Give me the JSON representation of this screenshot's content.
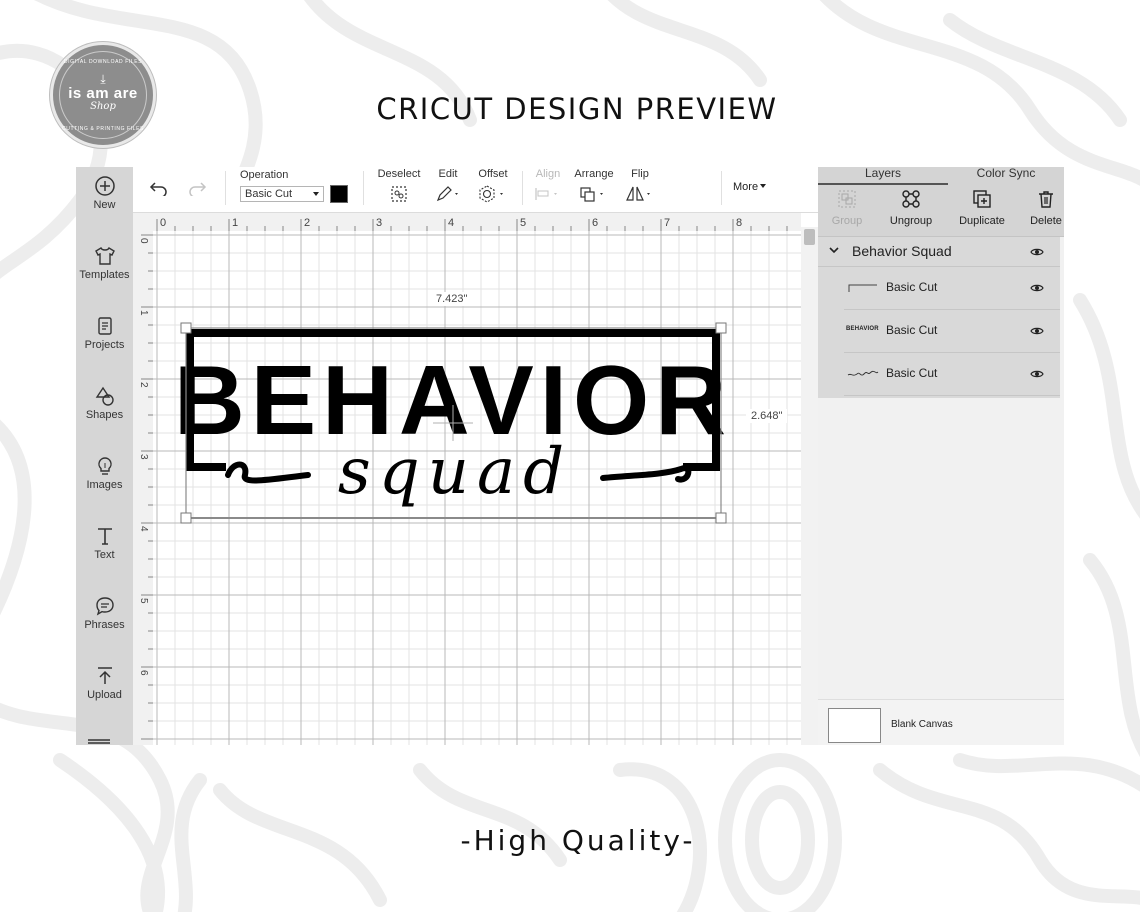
{
  "page": {
    "title": "CRICUT DESIGN PREVIEW",
    "footer": "-High Quality-"
  },
  "logo": {
    "arc_top": "DIGITAL DOWNLOAD FILES",
    "name": "is am are",
    "sub": "Shop",
    "arc_bottom": "CUTTING & PRINTING FILES",
    "icon": "download-icon"
  },
  "sidebar": {
    "items": [
      {
        "label": "New",
        "icon": "plus-circle-icon"
      },
      {
        "label": "Templates",
        "icon": "shirt-icon"
      },
      {
        "label": "Projects",
        "icon": "projects-icon"
      },
      {
        "label": "Shapes",
        "icon": "shapes-icon"
      },
      {
        "label": "Images",
        "icon": "lightbulb-icon"
      },
      {
        "label": "Text",
        "icon": "text-icon"
      },
      {
        "label": "Phrases",
        "icon": "speech-bubble-icon"
      },
      {
        "label": "Upload",
        "icon": "upload-icon"
      }
    ]
  },
  "toolbar": {
    "operation_label": "Operation",
    "operation_value": "Basic Cut",
    "operation_color": "#000000",
    "deselect_label": "Deselect",
    "edit_label": "Edit",
    "offset_label": "Offset",
    "align_label": "Align",
    "arrange_label": "Arrange",
    "flip_label": "Flip",
    "more_label": "More"
  },
  "canvas": {
    "ruler_top": [
      "0",
      "1",
      "2",
      "3",
      "4",
      "5",
      "6",
      "7",
      "8"
    ],
    "ruler_left": [
      "0",
      "1",
      "2",
      "3",
      "4",
      "5",
      "6"
    ],
    "width_label": "7.423\"",
    "height_label": "2.648\"",
    "design_word_1": "BEHAVIOR",
    "design_word_2": "squad"
  },
  "right_panel": {
    "tabs": [
      "Layers",
      "Color Sync"
    ],
    "active_tab": "Layers",
    "actions": [
      {
        "label": "Group",
        "icon": "group-icon",
        "enabled": false
      },
      {
        "label": "Ungroup",
        "icon": "ungroup-icon",
        "enabled": true
      },
      {
        "label": "Duplicate",
        "icon": "duplicate-icon",
        "enabled": true
      },
      {
        "label": "Delete",
        "icon": "trash-icon",
        "enabled": true
      }
    ],
    "group_name": "Behavior Squad",
    "layers": [
      {
        "label": "Basic Cut",
        "thumb": "frame"
      },
      {
        "label": "Basic Cut",
        "thumb_text": "BEHAVIOR"
      },
      {
        "label": "Basic Cut",
        "thumb": "squad-script"
      }
    ],
    "blank_canvas_label": "Blank Canvas"
  }
}
